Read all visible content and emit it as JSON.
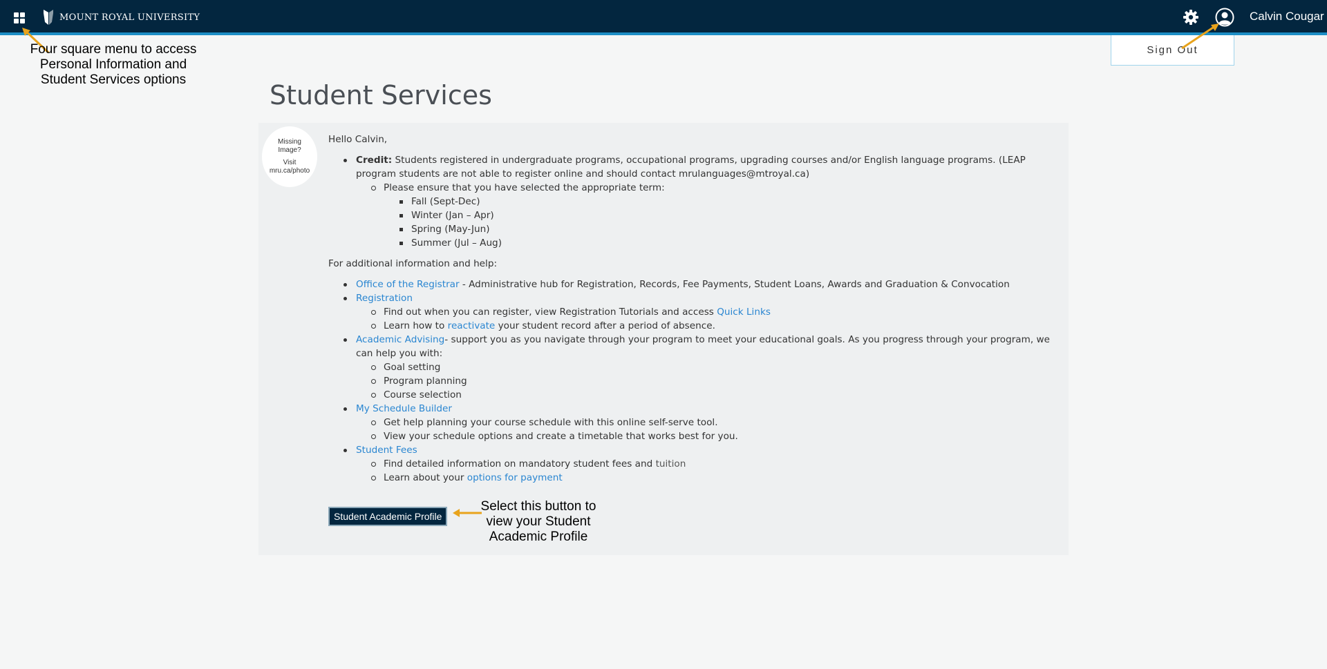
{
  "brand": {
    "name": "MOUNT ROYAL UNIVERSITY"
  },
  "header": {
    "user_name": "Calvin Cougar",
    "sign_out_label": "Sign Out"
  },
  "icons": {
    "menu": "four-square-menu-icon",
    "settings": "gear-icon",
    "user": "user-avatar-icon"
  },
  "annotations": {
    "menu_note": "Four square menu to access Personal Information and Student Services options",
    "button_note": "Select this button to view your Student Academic Profile"
  },
  "page": {
    "title": "Student Services",
    "photo_placeholder": {
      "line1": "Missing Image?",
      "line2": "Visit mru.ca/photo"
    },
    "greeting": "Hello Calvin,",
    "credit_label": "Credit:",
    "credit_text": " Students registered in undergraduate programs, occupational programs, upgrading courses and/or English language programs. (LEAP program students are not able to register online and should contact mrulanguages@mtroyal.ca)",
    "term_intro": "Please ensure that you have selected the appropriate term:",
    "terms": [
      "Fall (Sept-Dec)",
      "Winter (Jan – Apr)",
      "Spring (May-Jun)",
      "Summer (Jul – Aug)"
    ],
    "help_intro": "For additional information and help:",
    "registrar_link": "Office of the Registrar",
    "registrar_text": " - Administrative hub for Registration, Records, Fee Payments, Student Loans, Awards and Graduation & Convocation",
    "registration_link": "Registration",
    "registration_1_text": "Find out when you can register, view Registration Tutorials and access ",
    "quick_links": "Quick Links",
    "registration_2_pre": "Learn how to ",
    "reactivate_link": "reactivate",
    "registration_2_post": " your student record after a period of absence.",
    "advising_link": "Academic Advising",
    "advising_text": "- support you as you navigate through your program to meet your educational goals. As you progress through your program, we can help you with:",
    "advising_items": [
      "Goal setting",
      "Program planning",
      "Course selection"
    ],
    "schedule_link": "My Schedule Builder",
    "schedule_items": [
      "Get help planning your course schedule with this online self-serve tool.",
      "View your schedule options and create a timetable that works best for you."
    ],
    "fees_link": "Student Fees",
    "fees_1_text": "Find detailed information on mandatory student fees and ",
    "tuition_link": "tuition",
    "fees_2_text": "Learn about your ",
    "payment_link": "options for payment",
    "profile_button": "Student Academic Profile"
  },
  "colors": {
    "topbar": "#03263f",
    "accent": "#1d8ec5",
    "link": "#2a86d1",
    "annotation_arrow": "#e8a31c"
  }
}
